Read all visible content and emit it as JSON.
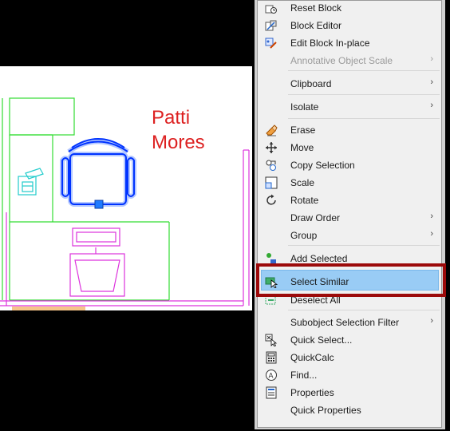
{
  "drawing": {
    "label_line1": "Patti",
    "label_line2": "Mores",
    "colors": {
      "walls": "#33dd33",
      "furniture": "#dd33dd",
      "label": "#dd2222",
      "selected_chair": "#0033ff",
      "phone": "#22cccc"
    }
  },
  "context_menu": {
    "items": [
      {
        "label": "Reset Block",
        "icon": "reset-block-icon",
        "submenu": false,
        "disabled": false
      },
      {
        "label": "Block Editor",
        "icon": "block-editor-icon",
        "submenu": false,
        "disabled": false
      },
      {
        "label": "Edit Block In-place",
        "icon": "edit-block-in-place-icon",
        "submenu": false,
        "disabled": false
      },
      {
        "label": "Annotative Object Scale",
        "icon": "",
        "submenu": true,
        "disabled": true
      },
      {
        "label": "Clipboard",
        "icon": "",
        "submenu": true,
        "disabled": false
      },
      {
        "label": "Isolate",
        "icon": "",
        "submenu": true,
        "disabled": false
      },
      {
        "label": "Erase",
        "icon": "eraser-icon",
        "submenu": false,
        "disabled": false
      },
      {
        "label": "Move",
        "icon": "move-icon",
        "submenu": false,
        "disabled": false
      },
      {
        "label": "Copy Selection",
        "icon": "copy-selection-icon",
        "submenu": false,
        "disabled": false
      },
      {
        "label": "Scale",
        "icon": "scale-icon",
        "submenu": false,
        "disabled": false
      },
      {
        "label": "Rotate",
        "icon": "rotate-icon",
        "submenu": false,
        "disabled": false
      },
      {
        "label": "Draw Order",
        "icon": "",
        "submenu": true,
        "disabled": false
      },
      {
        "label": "Group",
        "icon": "",
        "submenu": true,
        "disabled": false
      },
      {
        "label": "Add Selected",
        "icon": "add-selected-icon",
        "submenu": false,
        "disabled": false
      },
      {
        "label": "Select Similar",
        "icon": "select-similar-icon",
        "submenu": false,
        "disabled": false,
        "highlighted": true
      },
      {
        "label": "Deselect All",
        "icon": "deselect-all-icon",
        "submenu": false,
        "disabled": false
      },
      {
        "label": "Subobject Selection Filter",
        "icon": "",
        "submenu": true,
        "disabled": false
      },
      {
        "label": "Quick Select...",
        "icon": "quick-select-icon",
        "submenu": false,
        "disabled": false
      },
      {
        "label": "QuickCalc",
        "icon": "calculator-icon",
        "submenu": false,
        "disabled": false
      },
      {
        "label": "Find...",
        "icon": "find-icon",
        "submenu": false,
        "disabled": false
      },
      {
        "label": "Properties",
        "icon": "properties-icon",
        "submenu": false,
        "disabled": false
      },
      {
        "label": "Quick Properties",
        "icon": "",
        "submenu": false,
        "disabled": false
      }
    ],
    "submenu_arrow": "›",
    "callout_color": "#9c0a0a"
  }
}
